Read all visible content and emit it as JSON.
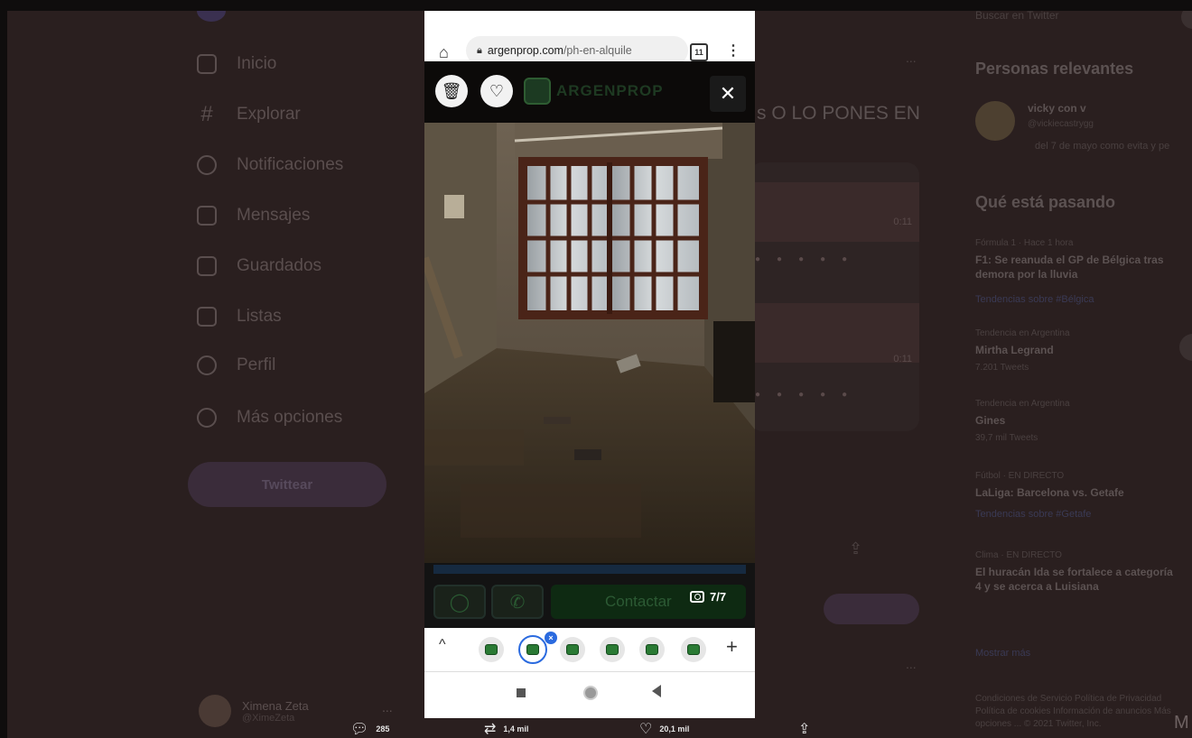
{
  "sidebar": {
    "items": [
      {
        "label": "Inicio",
        "icon": "home-icon"
      },
      {
        "label": "Explorar",
        "icon": "hashtag-icon"
      },
      {
        "label": "Notificaciones",
        "icon": "bell-icon"
      },
      {
        "label": "Mensajes",
        "icon": "mail-icon"
      },
      {
        "label": "Guardados",
        "icon": "bookmark-icon"
      },
      {
        "label": "Listas",
        "icon": "list-icon"
      },
      {
        "label": "Perfil",
        "icon": "person-icon"
      },
      {
        "label": "Más opciones",
        "icon": "more-circle-icon"
      }
    ],
    "tweet_button": "Twittear",
    "profile": {
      "name": "Ximena Zeta",
      "handle": "@XimeZeta",
      "more": "..."
    }
  },
  "main": {
    "tweet_text_fragment": "s O LO PONES EN",
    "more": "...",
    "stats": {
      "replies": "285",
      "retweets": "1,4 mil",
      "likes": "20,1 mil"
    }
  },
  "right": {
    "search_placeholder": "Buscar en Twitter",
    "relevant_title": "Personas relevantes",
    "relevant_user": {
      "name": "vicky con v",
      "handle": "@vickiecastrygg",
      "bio": "del 7 de mayo como evita y pe"
    },
    "whats_happening_title": "Qué está pasando",
    "trends": [
      {
        "context": "Fórmula 1 · Hace 1 hora",
        "title": "F1: Se reanuda el GP de Bélgica tras demora por la lluvia",
        "extra": "Tendencias sobre #Bélgica"
      },
      {
        "context": "Tendencia en Argentina",
        "title": "Mirtha Legrand",
        "extra": "7.201 Tweets"
      },
      {
        "context": "Tendencia en Argentina",
        "title": "Gines",
        "extra": "39,7 mil Tweets"
      },
      {
        "context": "Fútbol · EN DIRECTO",
        "title": "LaLiga: Barcelona vs. Getafe",
        "extra": "Tendencias sobre #Getafe"
      },
      {
        "context": "Clima · EN DIRECTO",
        "title": "El huracán Ida se fortalece a categoría 4 y se acerca a Luisiana",
        "extra": ""
      }
    ],
    "show_more": "Mostrar más",
    "footer": "Condiciones de Servicio  Política de Privacidad  Política de cookies  Información de anuncios  Más opciones ...  © 2021 Twitter, Inc.",
    "footer_m": "M"
  },
  "browser": {
    "url_domain": "argenprop.com",
    "url_path": "/ph-en-alquile",
    "tab_count": "11"
  },
  "argenprop": {
    "logo_text": "ARGENPROP",
    "contact_label": "Contactar",
    "photo_counter": "7/7"
  },
  "tabstrip": {
    "tabs": 6,
    "active_index": 1,
    "badge": "×"
  },
  "colors": {
    "accent": "#2a6adf",
    "brand_green": "#2e5c32",
    "dim_bg": "#2a1f1f"
  }
}
